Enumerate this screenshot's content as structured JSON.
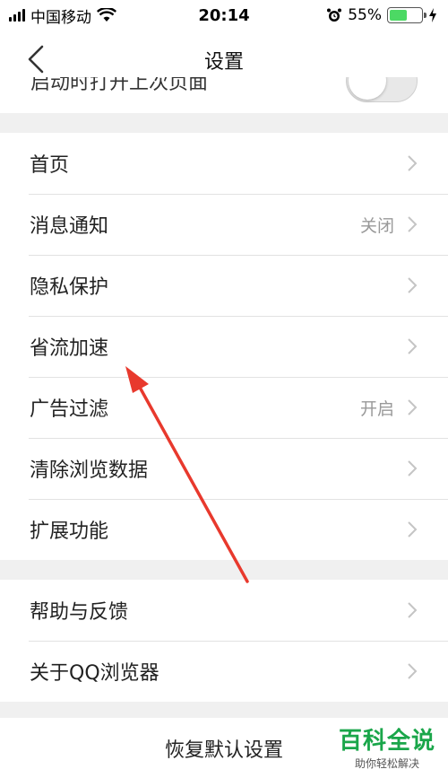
{
  "status_bar": {
    "carrier": "中国移动",
    "time": "20:14",
    "battery_percent": "55%",
    "battery_level": 0.55,
    "battery_color": "#4cd964"
  },
  "nav": {
    "title": "设置",
    "back_icon": "chevron-left-icon"
  },
  "partial_row": {
    "label": "启动时打开上次页面",
    "toggle_on": false
  },
  "group1": [
    {
      "label": "首页",
      "value": ""
    },
    {
      "label": "消息通知",
      "value": "关闭"
    },
    {
      "label": "隐私保护",
      "value": ""
    },
    {
      "label": "省流加速",
      "value": ""
    },
    {
      "label": "广告过滤",
      "value": "开启"
    },
    {
      "label": "清除浏览数据",
      "value": ""
    },
    {
      "label": "扩展功能",
      "value": ""
    }
  ],
  "group2": [
    {
      "label": "帮助与反馈",
      "value": ""
    },
    {
      "label": "关于QQ浏览器",
      "value": ""
    }
  ],
  "restore": {
    "label": "恢复默认设置"
  },
  "watermark": {
    "title": "百科全说",
    "subtitle": "助你轻松解决"
  },
  "colors": {
    "arrow": "#e8392d",
    "watermark": "#1aa64a"
  }
}
